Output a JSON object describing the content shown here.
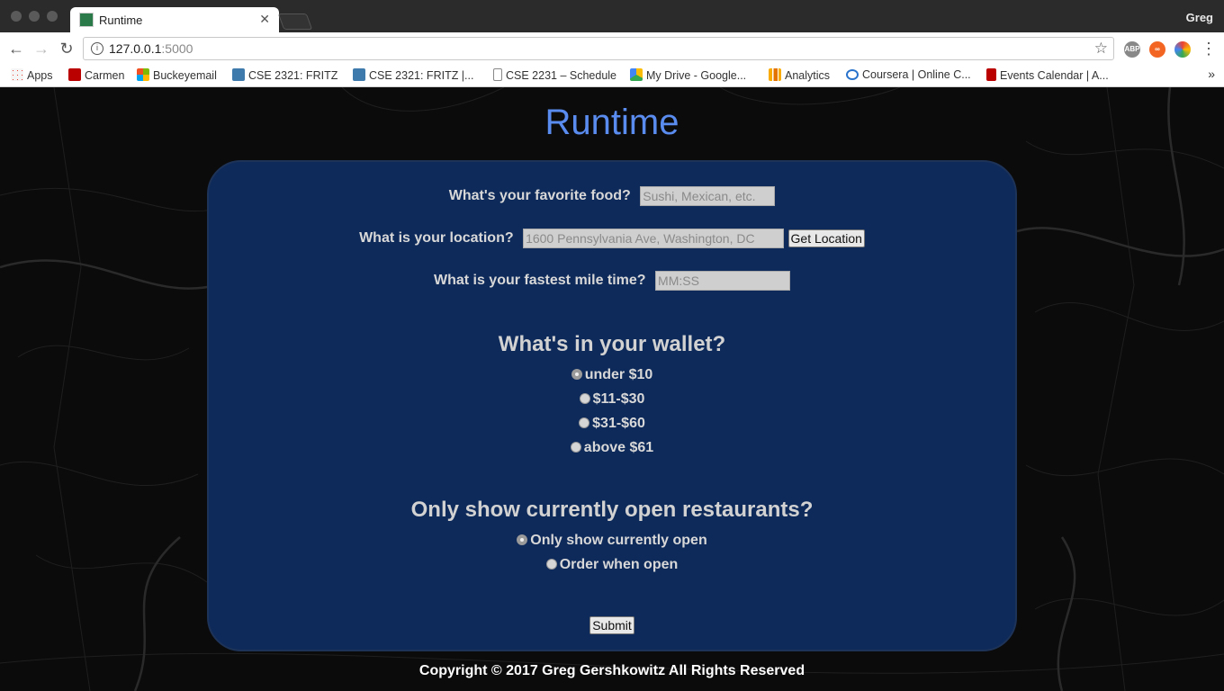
{
  "browser": {
    "tab_title": "Runtime",
    "profile_name": "Greg",
    "url_host": "127.0.0.1",
    "url_port": ":5000",
    "bookmarks": [
      {
        "label": "Apps",
        "icon": "apps-grid-icon",
        "color": "#4285f4"
      },
      {
        "label": "Carmen",
        "icon": "carmen-icon",
        "color": "#bb0000"
      },
      {
        "label": "Buckeyemail",
        "icon": "microsoft-icon",
        "color": "#f25022"
      },
      {
        "label": "CSE 2321: FRITZ",
        "icon": "piazza-icon",
        "color": "#3e7aab"
      },
      {
        "label": "CSE 2321: FRITZ |...",
        "icon": "piazza-icon",
        "color": "#3e7aab"
      },
      {
        "label": "CSE 2231 – Schedule",
        "icon": "page-icon",
        "color": "#888888"
      },
      {
        "label": "My Drive - Google...",
        "icon": "google-drive-icon",
        "color": "#34a853"
      },
      {
        "label": "Analytics",
        "icon": "analytics-icon",
        "color": "#f9ab00"
      },
      {
        "label": "Coursera | Online C...",
        "icon": "coursera-icon",
        "color": "#2a73cc"
      },
      {
        "label": "Events Calendar | A...",
        "icon": "calendar-icon",
        "color": "#bb0000"
      }
    ]
  },
  "page": {
    "title": "Runtime",
    "food": {
      "label": "What's your favorite food?",
      "placeholder": "Sushi, Mexican, etc."
    },
    "location": {
      "label": "What is your location?",
      "placeholder": "1600 Pennsylvania Ave, Washington, DC",
      "button": "Get Location"
    },
    "mile": {
      "label": "What is your fastest mile time?",
      "placeholder": "MM:SS"
    },
    "wallet": {
      "heading": "What's in your wallet?",
      "options": [
        {
          "label": "under $10",
          "checked": true
        },
        {
          "label": "$11-$30",
          "checked": false
        },
        {
          "label": "$31-$60",
          "checked": false
        },
        {
          "label": "above $61",
          "checked": false
        }
      ]
    },
    "open": {
      "heading": "Only show currently open restaurants?",
      "options": [
        {
          "label": "Only show currently open",
          "checked": true
        },
        {
          "label": "Order when open",
          "checked": false
        }
      ]
    },
    "submit": "Submit",
    "footer": "Copyright © 2017 Greg Gershkowitz All Rights Reserved"
  },
  "colors": {
    "title": "#5a8cf0",
    "card_bg": "#0e2a5a",
    "page_bg": "#0b0b0b"
  }
}
